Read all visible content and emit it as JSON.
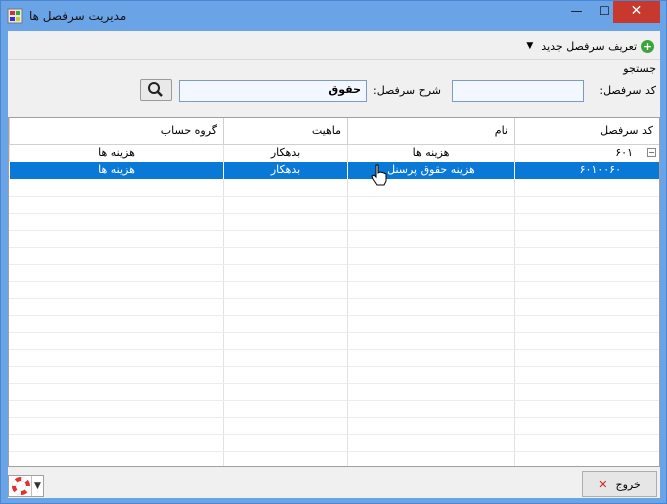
{
  "window": {
    "title": "مدیریت سرفصل ها",
    "minimize_glyph": "—",
    "maximize_glyph": "☐",
    "close_glyph": "✕"
  },
  "menu": {
    "new_heading_label": "تعریف سرفصل جدید",
    "dropdown_glyph": "▼"
  },
  "search": {
    "group_title": "جستجو",
    "code_label": "کد سرفصل:",
    "code_value": "",
    "description_label": "شرح سرفصل:",
    "description_value": "حقوق"
  },
  "grid": {
    "columns": [
      "کد سرفصل",
      "نام",
      "ماهیت",
      "گروه حساب"
    ],
    "rows": [
      {
        "code": "۶۰۱",
        "name": "هزینه ها",
        "nature": "بدهکار",
        "group": "هزینه ها",
        "selected": false,
        "toggle": "−"
      },
      {
        "code": "۶۰۱۰۰۶۰",
        "name": "هزینه حقوق پرسنل",
        "nature": "بدهکار",
        "group": "هزینه ها",
        "selected": true,
        "toggle": ""
      }
    ]
  },
  "footer": {
    "exit_label": "خروج",
    "exit_glyph": "✕",
    "combo_arrow": "▼"
  },
  "colors": {
    "title_bar": "#6ba4e6",
    "selection": "#0a78d7",
    "close_button": "#c7392c",
    "exit_icon": "#d22222"
  },
  "icons": [
    "app-icon",
    "minimize-icon",
    "maximize-icon",
    "close-icon",
    "add-icon",
    "search-icon",
    "exit-icon",
    "lifebuoy-icon",
    "hand-cursor-icon"
  ]
}
